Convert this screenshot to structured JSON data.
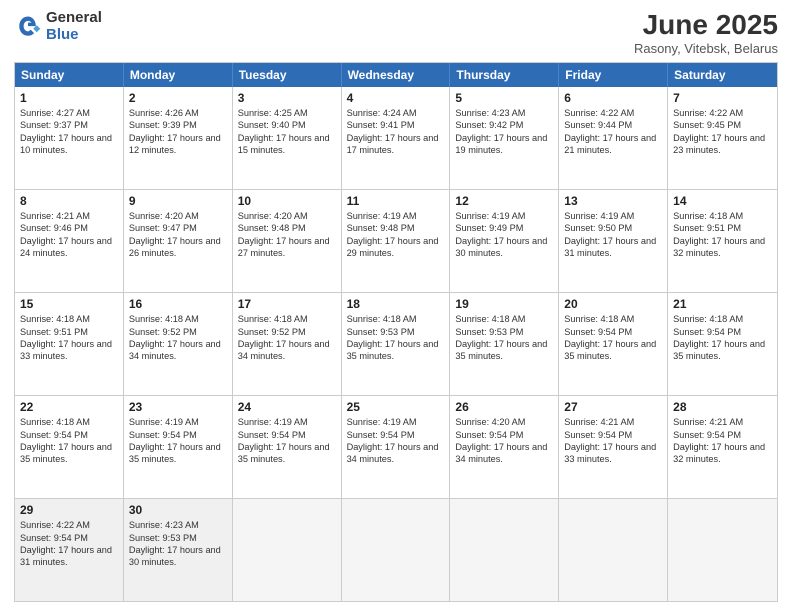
{
  "header": {
    "logo_general": "General",
    "logo_blue": "Blue",
    "title": "June 2025",
    "location": "Rasony, Vitebsk, Belarus"
  },
  "days": [
    "Sunday",
    "Monday",
    "Tuesday",
    "Wednesday",
    "Thursday",
    "Friday",
    "Saturday"
  ],
  "weeks": [
    [
      {
        "day": 1,
        "sun": "Sunrise: 4:27 AM",
        "set": "Sunset: 9:37 PM",
        "day_text": "Daylight: 17 hours and 10 minutes."
      },
      {
        "day": 2,
        "sun": "Sunrise: 4:26 AM",
        "set": "Sunset: 9:39 PM",
        "day_text": "Daylight: 17 hours and 12 minutes."
      },
      {
        "day": 3,
        "sun": "Sunrise: 4:25 AM",
        "set": "Sunset: 9:40 PM",
        "day_text": "Daylight: 17 hours and 15 minutes."
      },
      {
        "day": 4,
        "sun": "Sunrise: 4:24 AM",
        "set": "Sunset: 9:41 PM",
        "day_text": "Daylight: 17 hours and 17 minutes."
      },
      {
        "day": 5,
        "sun": "Sunrise: 4:23 AM",
        "set": "Sunset: 9:42 PM",
        "day_text": "Daylight: 17 hours and 19 minutes."
      },
      {
        "day": 6,
        "sun": "Sunrise: 4:22 AM",
        "set": "Sunset: 9:44 PM",
        "day_text": "Daylight: 17 hours and 21 minutes."
      },
      {
        "day": 7,
        "sun": "Sunrise: 4:22 AM",
        "set": "Sunset: 9:45 PM",
        "day_text": "Daylight: 17 hours and 23 minutes."
      }
    ],
    [
      {
        "day": 8,
        "sun": "Sunrise: 4:21 AM",
        "set": "Sunset: 9:46 PM",
        "day_text": "Daylight: 17 hours and 24 minutes."
      },
      {
        "day": 9,
        "sun": "Sunrise: 4:20 AM",
        "set": "Sunset: 9:47 PM",
        "day_text": "Daylight: 17 hours and 26 minutes."
      },
      {
        "day": 10,
        "sun": "Sunrise: 4:20 AM",
        "set": "Sunset: 9:48 PM",
        "day_text": "Daylight: 17 hours and 27 minutes."
      },
      {
        "day": 11,
        "sun": "Sunrise: 4:19 AM",
        "set": "Sunset: 9:48 PM",
        "day_text": "Daylight: 17 hours and 29 minutes."
      },
      {
        "day": 12,
        "sun": "Sunrise: 4:19 AM",
        "set": "Sunset: 9:49 PM",
        "day_text": "Daylight: 17 hours and 30 minutes."
      },
      {
        "day": 13,
        "sun": "Sunrise: 4:19 AM",
        "set": "Sunset: 9:50 PM",
        "day_text": "Daylight: 17 hours and 31 minutes."
      },
      {
        "day": 14,
        "sun": "Sunrise: 4:18 AM",
        "set": "Sunset: 9:51 PM",
        "day_text": "Daylight: 17 hours and 32 minutes."
      }
    ],
    [
      {
        "day": 15,
        "sun": "Sunrise: 4:18 AM",
        "set": "Sunset: 9:51 PM",
        "day_text": "Daylight: 17 hours and 33 minutes."
      },
      {
        "day": 16,
        "sun": "Sunrise: 4:18 AM",
        "set": "Sunset: 9:52 PM",
        "day_text": "Daylight: 17 hours and 34 minutes."
      },
      {
        "day": 17,
        "sun": "Sunrise: 4:18 AM",
        "set": "Sunset: 9:52 PM",
        "day_text": "Daylight: 17 hours and 34 minutes."
      },
      {
        "day": 18,
        "sun": "Sunrise: 4:18 AM",
        "set": "Sunset: 9:53 PM",
        "day_text": "Daylight: 17 hours and 35 minutes."
      },
      {
        "day": 19,
        "sun": "Sunrise: 4:18 AM",
        "set": "Sunset: 9:53 PM",
        "day_text": "Daylight: 17 hours and 35 minutes."
      },
      {
        "day": 20,
        "sun": "Sunrise: 4:18 AM",
        "set": "Sunset: 9:54 PM",
        "day_text": "Daylight: 17 hours and 35 minutes."
      },
      {
        "day": 21,
        "sun": "Sunrise: 4:18 AM",
        "set": "Sunset: 9:54 PM",
        "day_text": "Daylight: 17 hours and 35 minutes."
      }
    ],
    [
      {
        "day": 22,
        "sun": "Sunrise: 4:18 AM",
        "set": "Sunset: 9:54 PM",
        "day_text": "Daylight: 17 hours and 35 minutes."
      },
      {
        "day": 23,
        "sun": "Sunrise: 4:19 AM",
        "set": "Sunset: 9:54 PM",
        "day_text": "Daylight: 17 hours and 35 minutes."
      },
      {
        "day": 24,
        "sun": "Sunrise: 4:19 AM",
        "set": "Sunset: 9:54 PM",
        "day_text": "Daylight: 17 hours and 35 minutes."
      },
      {
        "day": 25,
        "sun": "Sunrise: 4:19 AM",
        "set": "Sunset: 9:54 PM",
        "day_text": "Daylight: 17 hours and 34 minutes."
      },
      {
        "day": 26,
        "sun": "Sunrise: 4:20 AM",
        "set": "Sunset: 9:54 PM",
        "day_text": "Daylight: 17 hours and 34 minutes."
      },
      {
        "day": 27,
        "sun": "Sunrise: 4:21 AM",
        "set": "Sunset: 9:54 PM",
        "day_text": "Daylight: 17 hours and 33 minutes."
      },
      {
        "day": 28,
        "sun": "Sunrise: 4:21 AM",
        "set": "Sunset: 9:54 PM",
        "day_text": "Daylight: 17 hours and 32 minutes."
      }
    ],
    [
      {
        "day": 29,
        "sun": "Sunrise: 4:22 AM",
        "set": "Sunset: 9:54 PM",
        "day_text": "Daylight: 17 hours and 31 minutes."
      },
      {
        "day": 30,
        "sun": "Sunrise: 4:23 AM",
        "set": "Sunset: 9:53 PM",
        "day_text": "Daylight: 17 hours and 30 minutes."
      },
      null,
      null,
      null,
      null,
      null
    ]
  ]
}
